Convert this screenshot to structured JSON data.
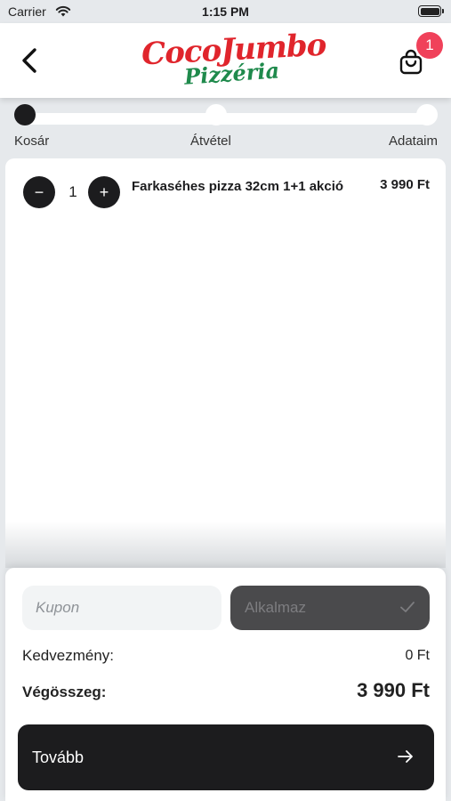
{
  "status_bar": {
    "carrier": "Carrier",
    "time": "1:15 PM"
  },
  "header": {
    "logo_line1": "CocoJumbo",
    "logo_line2": "Pizzéria",
    "cart_badge_count": "1",
    "icons": {
      "back": "chevron-left-icon",
      "cart": "shopping-bag-icon"
    }
  },
  "steps": [
    {
      "label": "Kosár",
      "active": true
    },
    {
      "label": "Átvétel",
      "active": false
    },
    {
      "label": "Adataim",
      "active": false
    }
  ],
  "cart": {
    "items": [
      {
        "quantity": "1",
        "decrement_label": "−",
        "increment_label": "+",
        "name": "Farkaséhes pizza 32cm 1+1 akció",
        "price": "3 990 Ft"
      }
    ]
  },
  "summary": {
    "coupon_placeholder": "Kupon",
    "apply_label": "Alkalmaz",
    "discount_label": "Kedvezmény:",
    "discount_value": "0 Ft",
    "total_label": "Végösszeg:",
    "total_value": "3 990 Ft",
    "next_label": "Tovább"
  },
  "colors": {
    "background": "#e6e9ec",
    "dark": "#1c1c1e",
    "badge": "#f0415a",
    "logo_red": "#e0252c",
    "logo_green": "#1f8a4c",
    "apply_button": "#4a4a4c"
  }
}
